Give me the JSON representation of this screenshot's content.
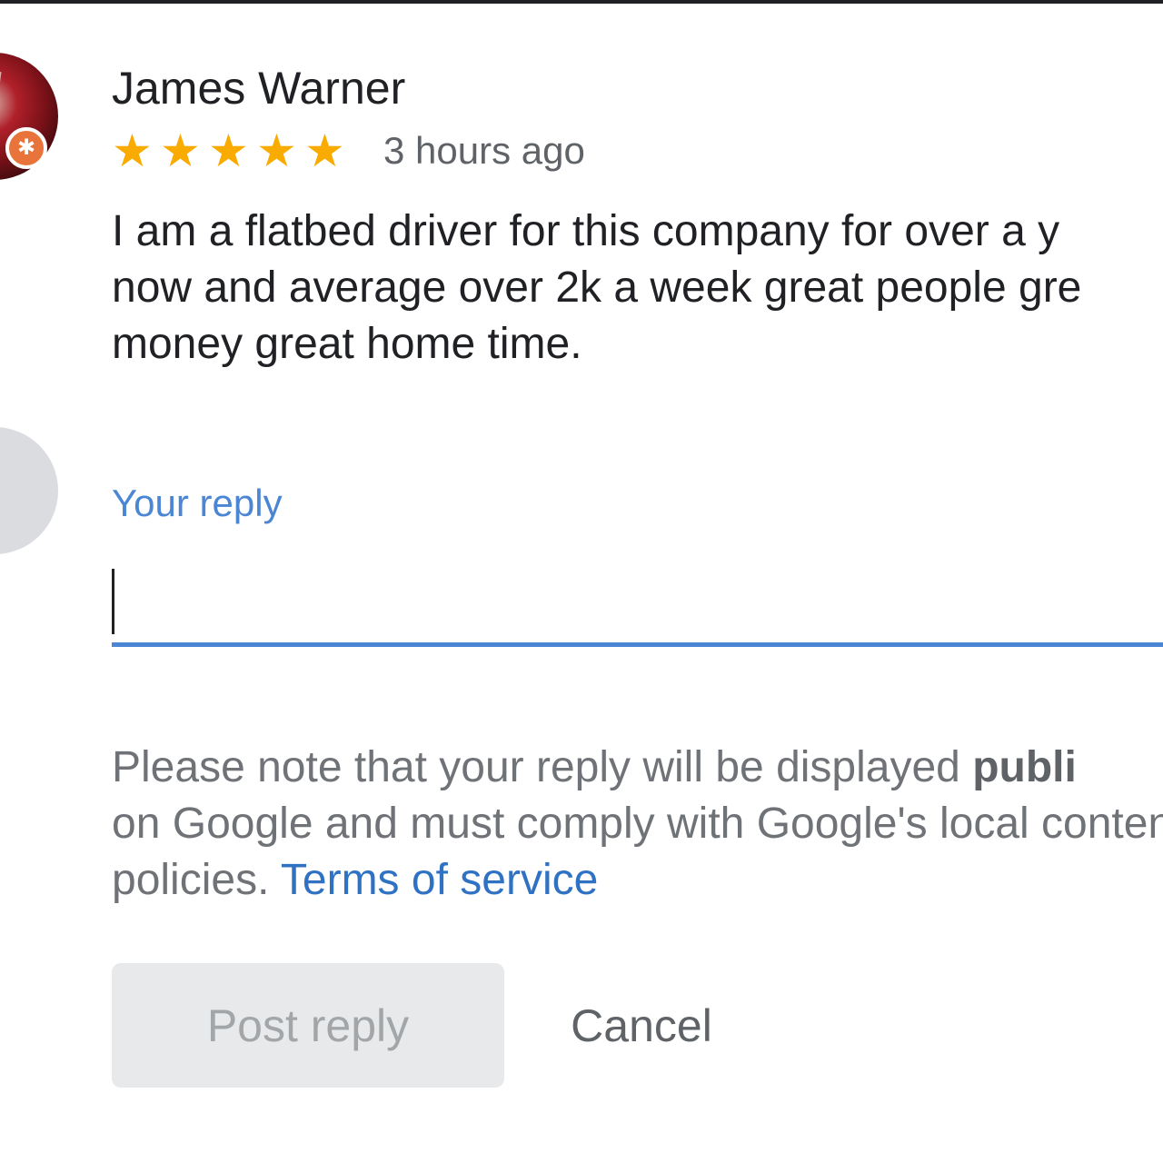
{
  "review": {
    "reviewer_name": "James Warner",
    "rating": 5,
    "rating_max": 5,
    "stars": [
      "★",
      "★",
      "★",
      "★",
      "★"
    ],
    "time_ago": "3 hours ago",
    "text": "I am a flatbed driver for this company for over a y\nnow and average over 2k a week great people gre\nmoney great home time.",
    "avatar_icon": "reviewer-avatar",
    "badge_icon": "local-guide-badge-icon",
    "badge_glyph": "✱",
    "star_color": "#f9ab00"
  },
  "reply": {
    "label": "Your reply",
    "value": "",
    "placeholder": "",
    "accent_color": "#4a86d4"
  },
  "notice": {
    "text_before": "Please note that your reply will be displayed ",
    "bold_text": "publi",
    "text_after": "on Google and must comply with Google's local content policies. ",
    "link_text": "Terms of service"
  },
  "actions": {
    "post_label": "Post reply",
    "cancel_label": "Cancel"
  }
}
